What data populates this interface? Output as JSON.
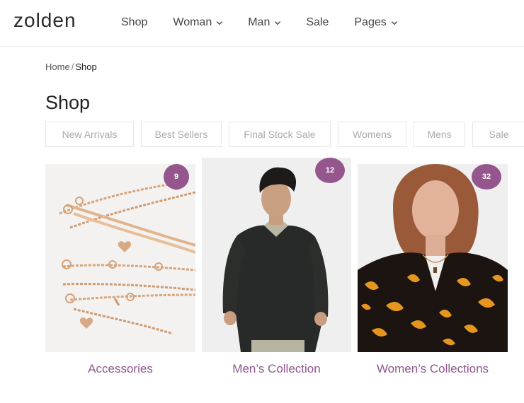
{
  "header": {
    "logo": "zolden",
    "nav": [
      {
        "label": "Shop",
        "has_dropdown": false
      },
      {
        "label": "Woman",
        "has_dropdown": true
      },
      {
        "label": "Man",
        "has_dropdown": true
      },
      {
        "label": "Sale",
        "has_dropdown": false
      },
      {
        "label": "Pages",
        "has_dropdown": true
      }
    ]
  },
  "breadcrumb": {
    "home": "Home",
    "separator": "/",
    "current": "Shop"
  },
  "page": {
    "title": "Shop"
  },
  "filters": [
    "New Arrivals",
    "Best Sellers",
    "Final Stock Sale",
    "Womens",
    "Mens",
    "Sale"
  ],
  "collections": [
    {
      "name": "Accessories",
      "count": "9",
      "image": "gold-chain-necklaces"
    },
    {
      "name": "Men’s Collection",
      "count": "12",
      "image": "man-dark-sweater"
    },
    {
      "name": "Women’s Collections",
      "count": "32",
      "image": "woman-floral-dress"
    }
  ],
  "colors": {
    "accent": "#94568c",
    "label": "#8e5690"
  }
}
